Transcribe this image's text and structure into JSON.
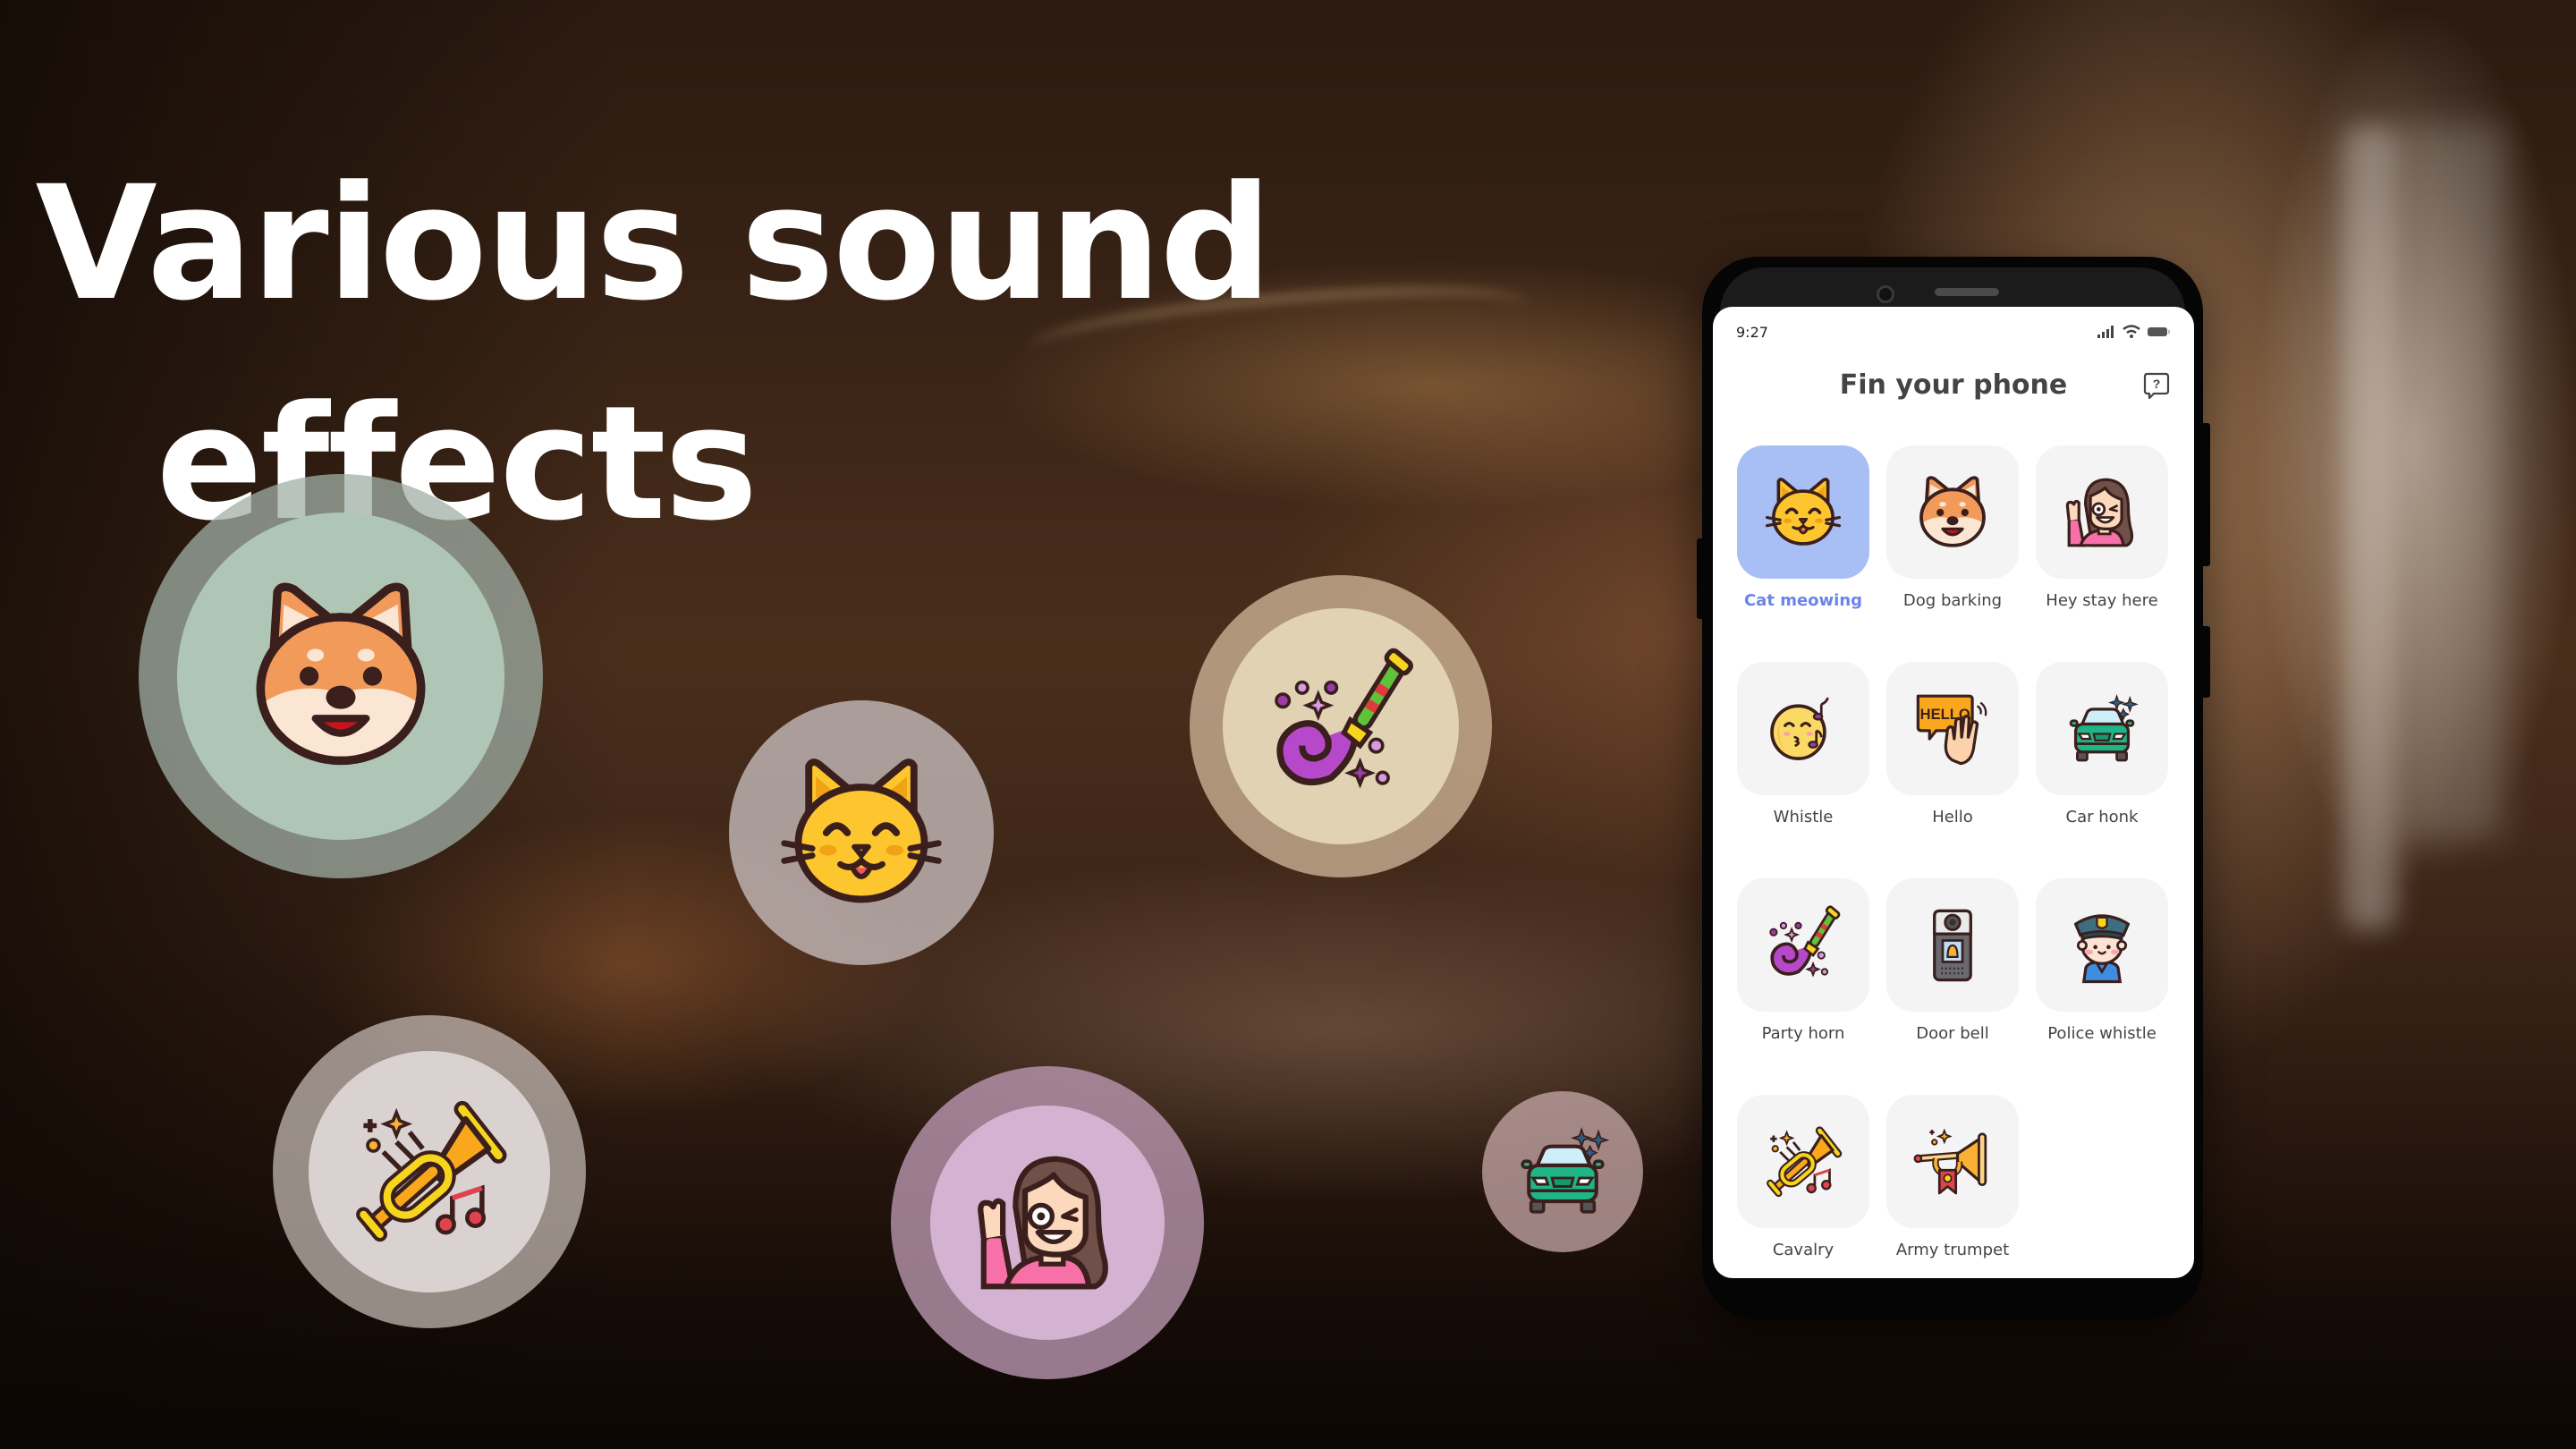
{
  "headline": {
    "line1": "Various sound",
    "line2": "effects"
  },
  "bubbles": [
    {
      "icon": "dog-icon",
      "label": "Dog"
    },
    {
      "icon": "cat-icon",
      "label": "Cat"
    },
    {
      "icon": "party-horn-icon",
      "label": "Party horn"
    },
    {
      "icon": "trumpet-icon",
      "label": "Trumpet"
    },
    {
      "icon": "waving-girl-icon",
      "label": "Girl waving"
    },
    {
      "icon": "car-icon",
      "label": "Car"
    }
  ],
  "phone": {
    "status_time": "9:27",
    "app_title": "Fin your phone",
    "help_icon": "help-chat-icon",
    "accent_color": "#6a84e8",
    "selected_tile_color": "#a8bff5",
    "sounds": [
      {
        "label": "Cat meowing",
        "icon": "cat-icon",
        "selected": true
      },
      {
        "label": "Dog barking",
        "icon": "dog-icon",
        "selected": false
      },
      {
        "label": "Hey stay here",
        "icon": "waving-girl-icon",
        "selected": false
      },
      {
        "label": "Whistle",
        "icon": "whistle-face-icon",
        "selected": false
      },
      {
        "label": "Hello",
        "icon": "hello-hand-icon",
        "selected": false
      },
      {
        "label": "Car honk",
        "icon": "car-icon",
        "selected": false
      },
      {
        "label": "Party horn",
        "icon": "party-horn-icon",
        "selected": false
      },
      {
        "label": "Door bell",
        "icon": "door-bell-icon",
        "selected": false
      },
      {
        "label": "Police whistle",
        "icon": "police-icon",
        "selected": false
      },
      {
        "label": "Cavalry",
        "icon": "trumpet-icon",
        "selected": false
      },
      {
        "label": "Army trumpet",
        "icon": "army-trumpet-icon",
        "selected": false
      }
    ],
    "hello_bubble_text": "HELLO"
  }
}
